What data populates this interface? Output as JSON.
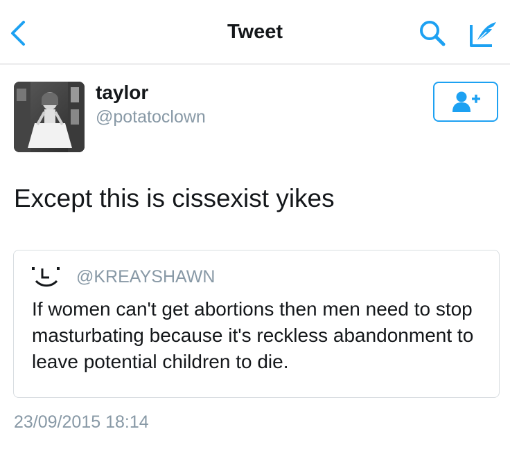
{
  "navbar": {
    "title": "Tweet",
    "back_icon": "chevron-left-icon",
    "search_icon": "search-icon",
    "compose_icon": "compose-quill-icon"
  },
  "author": {
    "display_name": "taylor",
    "username": "@potatoclown",
    "follow_icon": "follow-user-icon"
  },
  "tweet": {
    "text": "Except this is cissexist yikes",
    "timestamp": "23/09/2015 18:14"
  },
  "quoted_tweet": {
    "username": "@KREAYSHAWN",
    "text": "If women can't get abortions then men need to stop masturbating because it's reckless abandonment to leave potential children to die."
  },
  "colors": {
    "accent": "#1da1f2",
    "secondary_text": "#8899a6",
    "primary_text": "#14171a",
    "divider": "#c8c7cc"
  }
}
